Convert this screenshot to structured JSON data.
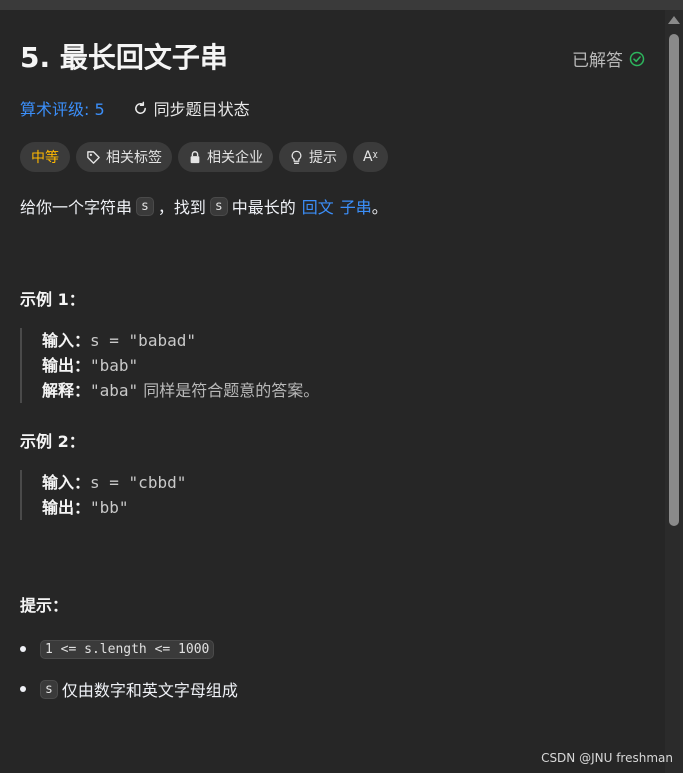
{
  "problem": {
    "title": "5. 最长回文子串",
    "solved_label": "已解答",
    "rating_label": "算术评级: 5",
    "sync_label": "同步题目状态"
  },
  "tags": {
    "difficulty": "中等",
    "related_tags": "相关标签",
    "related_companies": "相关企业",
    "hint": "提示",
    "translate": "Aᵡ"
  },
  "description": {
    "part1": "给你一个字符串",
    "var_s": "s",
    "part2": "，找到",
    "part3": "中最长的",
    "link1": "回文",
    "link2": "子串",
    "end": "。"
  },
  "examples": [
    {
      "heading": "示例 1：",
      "input_label": "输入：",
      "input_value": "s = \"babad\"",
      "output_label": "输出：",
      "output_value": "\"bab\"",
      "explain_label": "解释：",
      "explain_value": "\"aba\"",
      "explain_note": "同样是符合题意的答案。"
    },
    {
      "heading": "示例 2：",
      "input_label": "输入：",
      "input_value": "s = \"cbbd\"",
      "output_label": "输出：",
      "output_value": "\"bb\""
    }
  ],
  "constraints": {
    "heading": "提示：",
    "item1_code": "1 <= s.length <= 1000",
    "item2_code": "s",
    "item2_text": "仅由数字和英文字母组成"
  },
  "watermark": "CSDN @JNU freshman",
  "colors": {
    "accent": "#3b8ef8",
    "difficulty_medium": "#ffb800",
    "solved_check": "#2db55d"
  }
}
